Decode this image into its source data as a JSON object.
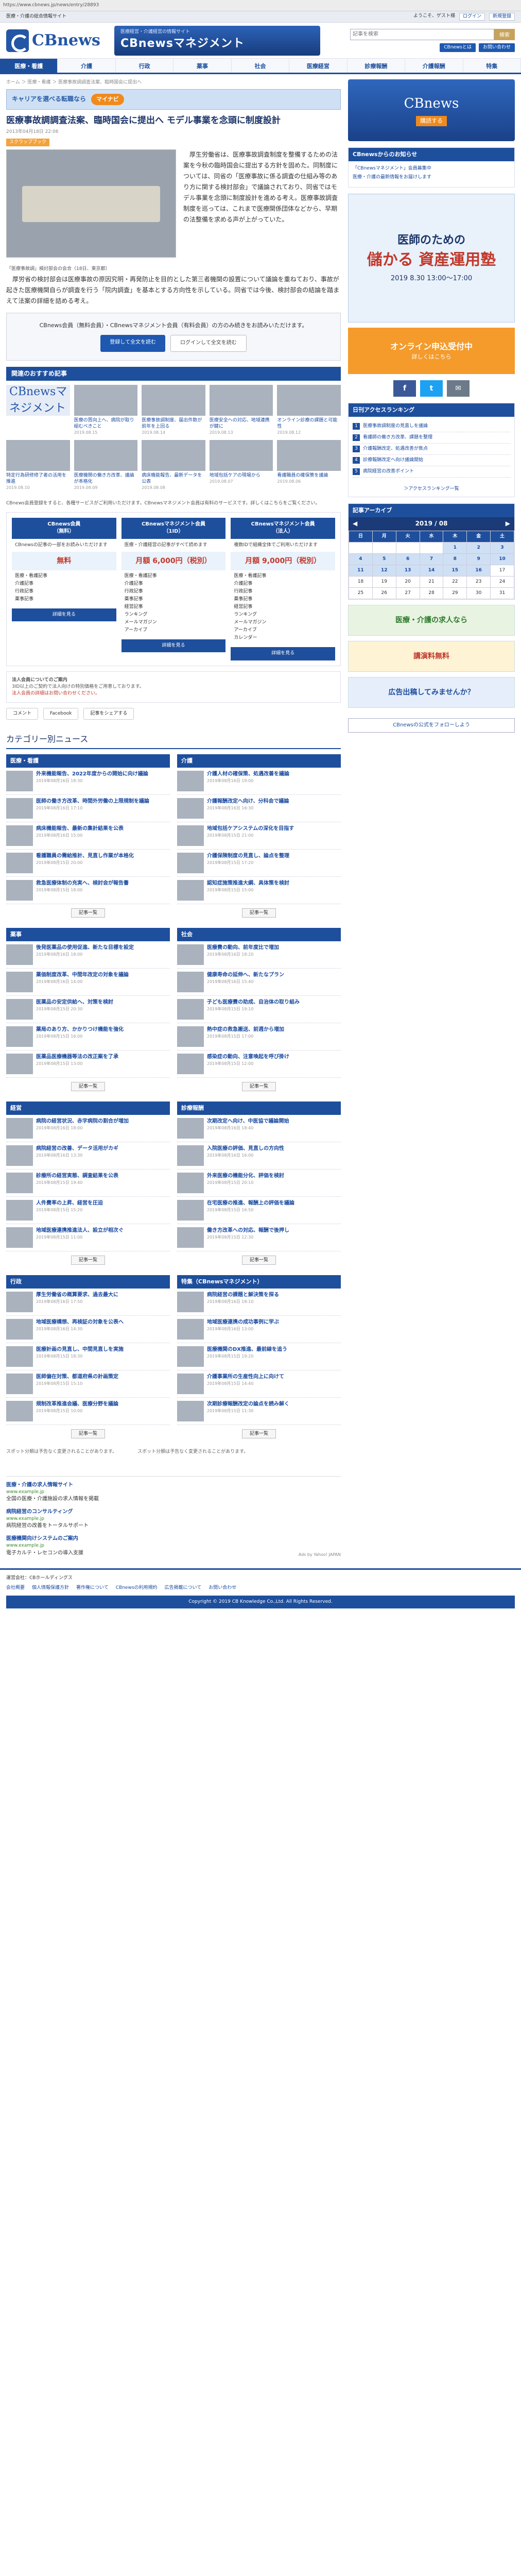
{
  "browser": {
    "url": "https://www.cbnews.jp/news/entry/28893"
  },
  "topbar": {
    "left": "医療・介護の総合情報サイト",
    "welcome": "ようこそ、ゲスト様",
    "login": "ログイン",
    "register": "新規登録"
  },
  "header": {
    "logo": "CBnews",
    "mgmt_sub": "医療経営・介護経営の情報サイト",
    "mgmt": "CBnewsマネジメント",
    "search_placeholder": "記事を検索",
    "search_btn": "検索",
    "links": [
      "CBnewsとは",
      "お問い合わせ"
    ]
  },
  "nav": [
    "医療・看護",
    "介護",
    "行政",
    "薬事",
    "社会",
    "医療経営",
    "診療報酬",
    "介護報酬",
    "特集"
  ],
  "crumb": "ホーム ＞ 医療・看護 ＞ 医療事故調調査法案、臨時国会に提出へ",
  "adbar": {
    "text": "キャリアを選べる転職なら",
    "btn": "マイナビ"
  },
  "article": {
    "title": "医療事故調調査法案、臨時国会に提出へ モデル事業を念頭に制度設計",
    "meta": "2013年04月18日 22:06",
    "tag": "スクラップブック",
    "caption": "「医療事故調」検討部会の会合（18日、東京都）",
    "p1": "厚生労働省は、医療事故調査制度を整備するための法案を今秋の臨時国会に提出する方針を固めた。同制度については、同省の「医療事故に係る調査の仕組み等のあり方に関する検討部会」で議論されており、同省ではモデル事業を念頭に制度設計を進める考え。医療事故調査制度を巡っては、これまで医療関係団体などから、早期の法整備を求める声が上がっていた。",
    "p2": "厚労省の検討部会は医療事故の原因究明・再発防止を目的とした第三者機関の設置について議論を重ねており、事故が起きた医療機関自らが調査を行う「院内調査」を基本とする方向性を示している。同省では今後、検討部会の結論を踏まえて法案の詳細を詰める考え。"
  },
  "login": {
    "text": "CBnews会員（無料会員）・CBnewsマネジメント会員（有料会員）の方のみ続きをお読みいただけます。",
    "register": "登録して全文を読む",
    "login": "ログインして全文を読む"
  },
  "rec": {
    "head": "関連のおすすめ記事",
    "items": [
      {
        "t": "CBnewsマネジメント",
        "d": ""
      },
      {
        "t": "医療の質向上へ、病院が取り組むべきこと",
        "d": "2019.08.15"
      },
      {
        "t": "医療事故調制度、届出件数が前年を上回る",
        "d": "2019.08.14"
      },
      {
        "t": "医療安全への対応、地域連携が鍵に",
        "d": "2019.08.13"
      },
      {
        "t": "オンライン診療の課題と可能性",
        "d": "2019.08.12"
      },
      {
        "t": "特定行為研修修了者の活用を推進",
        "d": "2019.08.10"
      },
      {
        "t": "医療機関の働き方改革、議論が本格化",
        "d": "2019.08.09"
      },
      {
        "t": "病床機能報告、最新データを公表",
        "d": "2019.08.08"
      },
      {
        "t": "地域包括ケアの現場から",
        "d": "2019.08.07"
      },
      {
        "t": "看護職員の確保策を議論",
        "d": "2019.08.06"
      }
    ]
  },
  "notice": "CBnews会員登録をすると、各種サービスがご利用いただけます。CBnewsマネジメント会員は有料のサービスです。詳しくはこちらをご覧ください。",
  "plans": [
    {
      "name": "CBnews会員",
      "sub": "（無料）",
      "desc": "CBnewsの記事の一部をお読みいただけます",
      "price": "無料",
      "go": "詳細を見る"
    },
    {
      "name": "CBnewsマネジメント会員",
      "sub": "（1ID）",
      "desc": "医療・介護経営の記事がすべて読めます",
      "price": "月額 6,000円（税別）",
      "go": "詳細を見る"
    },
    {
      "name": "CBnewsマネジメント会員",
      "sub": "（法人）",
      "desc": "複数IDで組織全体でご利用いただけます",
      "price": "月額 9,000円（税別）",
      "go": "詳細を見る"
    }
  ],
  "plan_features": [
    "医療・看護記事",
    "介護記事",
    "行政記事",
    "薬事記事",
    "経営記事",
    "ランキング",
    "メールマガジン",
    "アーカイブ",
    "カレンダー"
  ],
  "infobox": {
    "title": "法人会員についてのご案内",
    "text": "3ID以上のご契約で法人向けの特別価格をご用意しております。",
    "red": "法人会員の詳細はお問い合わせください。"
  },
  "social": {
    "comment": "コメント",
    "fb": "Facebook",
    "share": "記事をシェアする"
  },
  "cat": {
    "head": "カテゴリー別ニュース",
    "more": "記事一覧",
    "sections": [
      {
        "name": "医療・看護",
        "items": [
          {
            "t": "外来機能報告、2022年度からの開始に向け議論",
            "d": "2019年08月16日 18:30"
          },
          {
            "t": "医師の働き方改革、時間外労働の上限規制を議論",
            "d": "2019年08月16日 17:10"
          },
          {
            "t": "病床機能報告、最新の集計結果を公表",
            "d": "2019年08月16日 15:00"
          },
          {
            "t": "看護職員の需給推計、見直し作業が本格化",
            "d": "2019年08月15日 20:00"
          },
          {
            "t": "救急医療体制の充実へ、検討会が報告書",
            "d": "2019年08月15日 18:00"
          }
        ]
      },
      {
        "name": "介護",
        "items": [
          {
            "t": "介護人材の確保策、処遇改善を議論",
            "d": "2019年08月16日 19:00"
          },
          {
            "t": "介護報酬改定へ向け、分科会で議論",
            "d": "2019年08月16日 16:30"
          },
          {
            "t": "地域包括ケアシステムの深化を目指す",
            "d": "2019年08月15日 21:00"
          },
          {
            "t": "介護保険制度の見直し、論点を整理",
            "d": "2019年08月15日 17:20"
          },
          {
            "t": "認知症施策推進大綱、具体策を検討",
            "d": "2019年08月15日 15:00"
          }
        ]
      },
      {
        "name": "薬事",
        "items": [
          {
            "t": "後発医薬品の使用促進、新たな目標を設定",
            "d": "2019年08月16日 18:00"
          },
          {
            "t": "薬価制度改革、中間年改定の対象を議論",
            "d": "2019年08月16日 14:00"
          },
          {
            "t": "医薬品の安定供給へ、対策を検討",
            "d": "2019年08月15日 20:30"
          },
          {
            "t": "薬局のあり方、かかりつけ機能を強化",
            "d": "2019年08月15日 16:00"
          },
          {
            "t": "医薬品医療機器等法の改正案を了承",
            "d": "2019年08月15日 13:00"
          }
        ]
      },
      {
        "name": "社会",
        "items": [
          {
            "t": "医療費の動向、前年度比で増加",
            "d": "2019年08月16日 18:20"
          },
          {
            "t": "健康寿命の延伸へ、新たなプラン",
            "d": "2019年08月16日 15:40"
          },
          {
            "t": "子ども医療費の助成、自治体の取り組み",
            "d": "2019年08月15日 19:10"
          },
          {
            "t": "熱中症の救急搬送、前週から増加",
            "d": "2019年08月15日 17:00"
          },
          {
            "t": "感染症の動向、注意喚起を呼び掛け",
            "d": "2019年08月15日 12:00"
          }
        ]
      },
      {
        "name": "経営",
        "items": [
          {
            "t": "病院の経営状況、赤字病院の割合が増加",
            "d": "2019年08月16日 18:00"
          },
          {
            "t": "病院経営の改善、データ活用がカギ",
            "d": "2019年08月16日 13:30"
          },
          {
            "t": "診療所の経営実態、調査結果を公表",
            "d": "2019年08月15日 19:40"
          },
          {
            "t": "人件費率の上昇、経営を圧迫",
            "d": "2019年08月15日 15:20"
          },
          {
            "t": "地域医療連携推進法人、設立が相次ぐ",
            "d": "2019年08月15日 11:00"
          }
        ]
      },
      {
        "name": "診療報酬",
        "items": [
          {
            "t": "次期改定へ向け、中医協で議論開始",
            "d": "2019年08月16日 18:40"
          },
          {
            "t": "入院医療の評価、見直しの方向性",
            "d": "2019年08月16日 16:00"
          },
          {
            "t": "外来医療の機能分化、評価を検討",
            "d": "2019年08月15日 20:10"
          },
          {
            "t": "在宅医療の推進、報酬上の評価を議論",
            "d": "2019年08月15日 16:50"
          },
          {
            "t": "働き方改革への対応、報酬で後押し",
            "d": "2019年08月15日 12:30"
          }
        ]
      },
      {
        "name": "行政",
        "items": [
          {
            "t": "厚生労働省の概算要求、過去最大に",
            "d": "2019年08月16日 17:50"
          },
          {
            "t": "地域医療構想、再検証の対象を公表へ",
            "d": "2019年08月16日 14:30"
          },
          {
            "t": "医療計画の見直し、中間見直しを実施",
            "d": "2019年08月15日 18:30"
          },
          {
            "t": "医師偏在対策、都道府県の計画策定",
            "d": "2019年08月15日 15:10"
          },
          {
            "t": "規制改革推進会議、医療分野を議論",
            "d": "2019年08月15日 10:00"
          }
        ]
      },
      {
        "name": "特集（CBnewsマネジメント）",
        "items": [
          {
            "t": "病院経営の課題と解決策を探る",
            "d": "2019年08月16日 18:10"
          },
          {
            "t": "地域医療連携の成功事例に学ぶ",
            "d": "2019年08月16日 13:00"
          },
          {
            "t": "医療機関のDX推進、最前線を追う",
            "d": "2019年08月15日 19:20"
          },
          {
            "t": "介護事業所の生産性向上に向けて",
            "d": "2019年08月15日 14:40"
          },
          {
            "t": "次期診療報酬改定の論点を読み解く",
            "d": "2019年08月15日 11:30"
          }
        ]
      }
    ]
  },
  "bottomnote": {
    "a": "スポット分類は予告なく変更されることがあります。",
    "b": "スポット分類は予告なく変更されることがあります。"
  },
  "promos": [
    {
      "t": "医療・介護の求人情報サイト",
      "u": "www.example.jp",
      "d": "全国の医療・介護施設の求人情報を掲載"
    },
    {
      "t": "病院経営のコンサルティング",
      "u": "www.example.jp",
      "d": "病院経営の改善をトータルサポート"
    },
    {
      "t": "医療機関向けシステムのご案内",
      "u": "www.example.jp",
      "d": "電子カルテ・レセコンの導入支援"
    }
  ],
  "adsby": "Ads by Yahoo! JAPAN",
  "side": {
    "banner": {
      "b": "CBnews",
      "k": "購読する"
    },
    "notice": {
      "head": "CBnewsからのお知らせ",
      "items": [
        "「CBnewsマネジメント」会員募集中",
        "医療・介護の最新情報をお届けします"
      ]
    },
    "bigad": {
      "t1": "医師のための",
      "t2": "儲かる 資産運用塾",
      "d": "2019 8.30 13:00〜17:00"
    },
    "orangead": {
      "t": "オンライン申込受付中",
      "s": "詳しくはこちら"
    },
    "sns": [
      "f",
      "t",
      "✉"
    ],
    "rank": {
      "head": "日刊アクセスランキング",
      "items": [
        "医療事故調制度の見直しを議論",
        "看護師の働き方改革、課題を整理",
        "介護報酬改定、処遇改善が焦点",
        "診療報酬改定へ向け議論開始",
        "病院経営の改善ポイント"
      ],
      "more": "＞アクセスランキング一覧"
    },
    "cal": {
      "head": "記事アーカイブ",
      "month": "2019 / 08",
      "days": [
        "日",
        "月",
        "火",
        "水",
        "木",
        "金",
        "土"
      ]
    },
    "ads": [
      "医療・介護の求人なら",
      "講演料無料",
      "広告出稿してみませんか？"
    ],
    "tw": "CBnewsの公式をフォローしよう"
  },
  "footer": {
    "company": "運営会社：CBホールディングス",
    "links": [
      "会社概要",
      "個人情報保護方針",
      "著作権について",
      "CBnewsの利用規約",
      "広告掲載について",
      "お問い合わせ"
    ],
    "copy": "Copyright © 2019 CB Knowledge Co.,Ltd. All Rights Reserved."
  }
}
